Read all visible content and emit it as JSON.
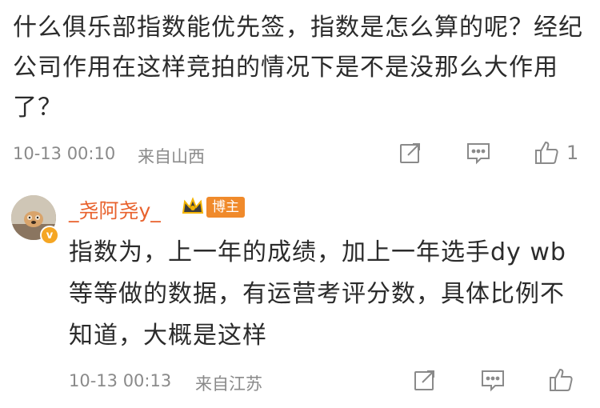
{
  "comment": {
    "text": "什么俱乐部指数能优先签，指数是怎么算的呢？经纪公司作用在这样竞拍的情况下是不是没那么大作用了？",
    "timestamp": "10-13 00:10",
    "location": "来自山西",
    "like_count": "1",
    "icons": [
      "share-icon",
      "comment-icon",
      "like-icon"
    ]
  },
  "reply": {
    "username": "_尧阿尧y_",
    "badge": "博主",
    "verified_mark": "v",
    "text": "指数为，上一年的成绩，加上一年选手dy wb等等做的数据，有运营考评分数，具体比例不知道，大概是这样",
    "timestamp": "10-13 00:13",
    "location": "来自江苏",
    "icons": [
      "share-icon",
      "comment-icon",
      "like-icon"
    ]
  },
  "colors": {
    "username": "#e8612c",
    "badge_bg": "#f08a2b",
    "meta": "#8a8a8a"
  }
}
